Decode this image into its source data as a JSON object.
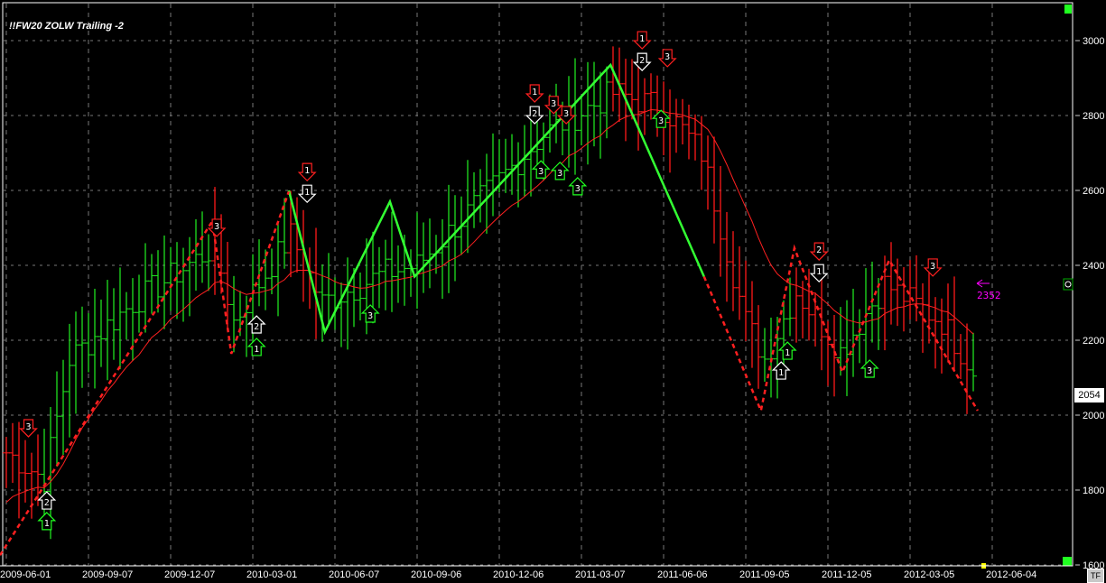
{
  "title": "!!FW20 ZOLW Trailing -2",
  "current_price": "2054",
  "target_label": "2352",
  "tf_button": "TF",
  "chart_data": {
    "type": "bar",
    "subtype": "ohlc-weekly",
    "y_ticks": [
      "3000",
      "2800",
      "2600",
      "2400",
      "2200",
      "2000",
      "1800",
      "1600"
    ],
    "ylim": [
      1600,
      3000
    ],
    "x_ticks": [
      "2009-06-01",
      "2009-09-07",
      "2009-12-07",
      "2010-03-01",
      "2010-06-07",
      "2010-09-06",
      "2010-12-06",
      "2011-03-07",
      "2011-06-06",
      "2011-09-05",
      "2011-12-05",
      "2012-03-05",
      "2012-06-04"
    ],
    "x_unit": "weeks since 2009-06-01",
    "price_path": [
      [
        0,
        1900
      ],
      [
        6,
        1830
      ],
      [
        10,
        2150
      ],
      [
        20,
        2300
      ],
      [
        33,
        2450
      ],
      [
        36,
        2250
      ],
      [
        45,
        2480
      ],
      [
        50,
        2300
      ],
      [
        60,
        2380
      ],
      [
        65,
        2400
      ],
      [
        85,
        2750
      ],
      [
        96,
        2860
      ],
      [
        104,
        2820
      ],
      [
        110,
        2700
      ],
      [
        117,
        2250
      ],
      [
        120,
        2150
      ],
      [
        125,
        2330
      ],
      [
        132,
        2170
      ],
      [
        139,
        2350
      ],
      [
        148,
        2250
      ],
      [
        153,
        2120
      ]
    ],
    "zigzag_solid": [
      [
        44.7,
        2600
      ],
      [
        50.4,
        2222
      ],
      [
        60.7,
        2570
      ],
      [
        64.6,
        2370
      ],
      [
        95.6,
        2935
      ],
      [
        110.4,
        2370
      ]
    ],
    "zigzag_dashed": [
      [
        [
          -1,
          1626
        ],
        [
          32.6,
          2518
        ],
        [
          35.6,
          2164
        ],
        [
          44.7,
          2597
        ]
      ],
      [
        [
          110.4,
          2370
        ],
        [
          119.4,
          2012
        ],
        [
          124.7,
          2446
        ],
        [
          132.3,
          2115
        ],
        [
          139.7,
          2414
        ],
        [
          153.7,
          2012
        ]
      ]
    ],
    "markers": [
      {
        "w": 3.5,
        "p": 1988,
        "dir": "down",
        "color": "#ff2020",
        "label": "3"
      },
      {
        "w": 6.4,
        "p": 1795,
        "dir": "up",
        "color": "#ffffff",
        "label": "2"
      },
      {
        "w": 6.4,
        "p": 1740,
        "dir": "up",
        "color": "#20ff20",
        "label": "1"
      },
      {
        "w": 33.3,
        "p": 2523,
        "dir": "down",
        "color": "#ff2020",
        "label": "3"
      },
      {
        "w": 39.6,
        "p": 2265,
        "dir": "up",
        "color": "#ffffff",
        "label": "2"
      },
      {
        "w": 39.6,
        "p": 2205,
        "dir": "up",
        "color": "#20ff20",
        "label": "1"
      },
      {
        "w": 47.6,
        "p": 2672,
        "dir": "down",
        "color": "#ff2020",
        "label": "1"
      },
      {
        "w": 47.6,
        "p": 2614,
        "dir": "down",
        "color": "#ffffff",
        "label": "1"
      },
      {
        "w": 57.6,
        "p": 2294,
        "dir": "up",
        "color": "#20ff20",
        "label": "3"
      },
      {
        "w": 83.6,
        "p": 2882,
        "dir": "down",
        "color": "#ff2020",
        "label": "1"
      },
      {
        "w": 83.6,
        "p": 2824,
        "dir": "down",
        "color": "#ffffff",
        "label": "2"
      },
      {
        "w": 86.6,
        "p": 2851,
        "dir": "down",
        "color": "#ff2020",
        "label": "3"
      },
      {
        "w": 88.6,
        "p": 2824,
        "dir": "down",
        "color": "#ff2020",
        "label": "3"
      },
      {
        "w": 84.6,
        "p": 2679,
        "dir": "up",
        "color": "#20ff20",
        "label": "3"
      },
      {
        "w": 87.6,
        "p": 2675,
        "dir": "up",
        "color": "#20ff20",
        "label": "3"
      },
      {
        "w": 90.4,
        "p": 2634,
        "dir": "up",
        "color": "#20ff20",
        "label": "3"
      },
      {
        "w": 100.6,
        "p": 3024,
        "dir": "down",
        "color": "#ff2020",
        "label": "1"
      },
      {
        "w": 100.6,
        "p": 2966,
        "dir": "down",
        "color": "#ffffff",
        "label": "2"
      },
      {
        "w": 104.6,
        "p": 2976,
        "dir": "down",
        "color": "#ff2020",
        "label": "3"
      },
      {
        "w": 103.6,
        "p": 2814,
        "dir": "up",
        "color": "#20ff20",
        "label": "3"
      },
      {
        "w": 128.6,
        "p": 2460,
        "dir": "down",
        "color": "#ff2020",
        "label": "2"
      },
      {
        "w": 128.6,
        "p": 2402,
        "dir": "down",
        "color": "#ffffff",
        "label": "1"
      },
      {
        "w": 123.6,
        "p": 2195,
        "dir": "up",
        "color": "#20ff20",
        "label": "1"
      },
      {
        "w": 122.6,
        "p": 2142,
        "dir": "up",
        "color": "#ffffff",
        "label": "1"
      },
      {
        "w": 136.6,
        "p": 2147,
        "dir": "up",
        "color": "#20ff20",
        "label": "3"
      },
      {
        "w": 146.6,
        "p": 2417,
        "dir": "down",
        "color": "#ff2020",
        "label": "3"
      }
    ]
  }
}
